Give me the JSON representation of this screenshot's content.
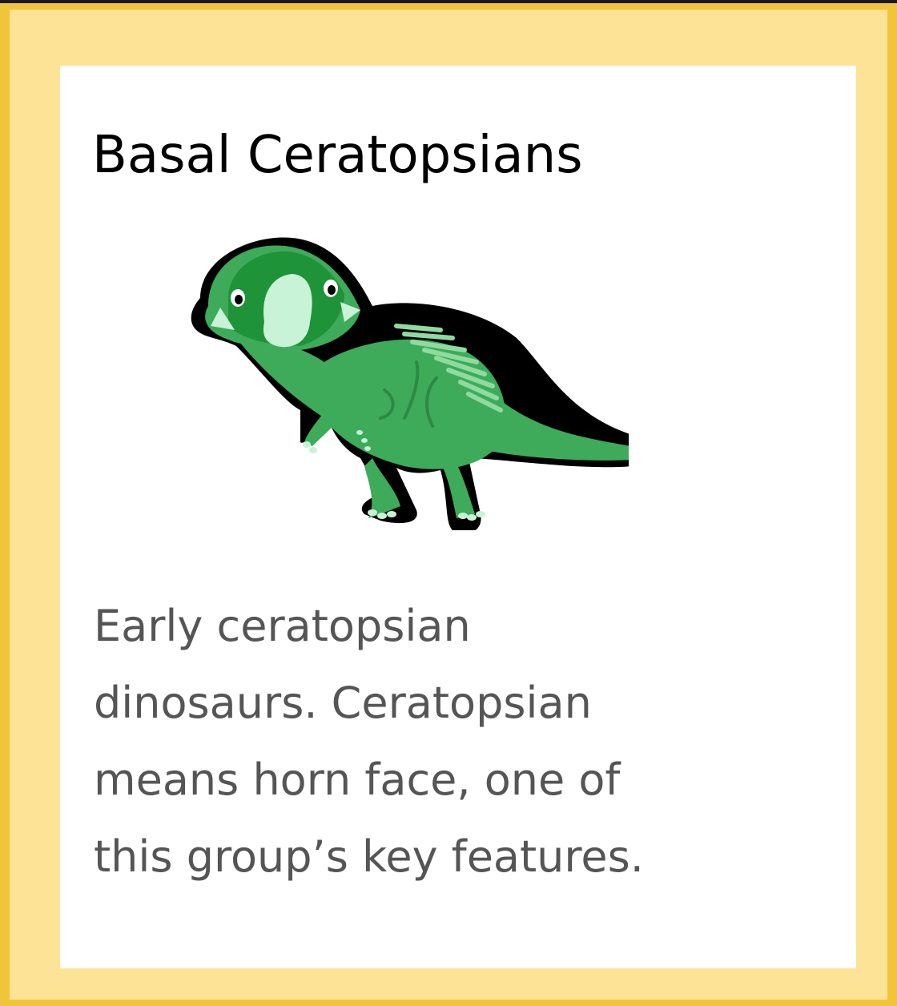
{
  "card": {
    "title": "Basal Ceratopsians",
    "illustration_icon": "ceratopsian-dinosaur-illustration",
    "description_lines": [
      "Early ceratopsian",
      "dinosaurs. Ceratopsian",
      "means horn face, one of",
      "this group’s key features."
    ]
  },
  "colors": {
    "frame": "#f2c43a",
    "frame_inner": "#fde396",
    "card_bg": "#ffffff",
    "dino_body": "#3eab5a",
    "dino_dark": "#1f9338",
    "dino_light": "#c9f3d6",
    "text_title": "#000000",
    "text_body": "#555555"
  }
}
